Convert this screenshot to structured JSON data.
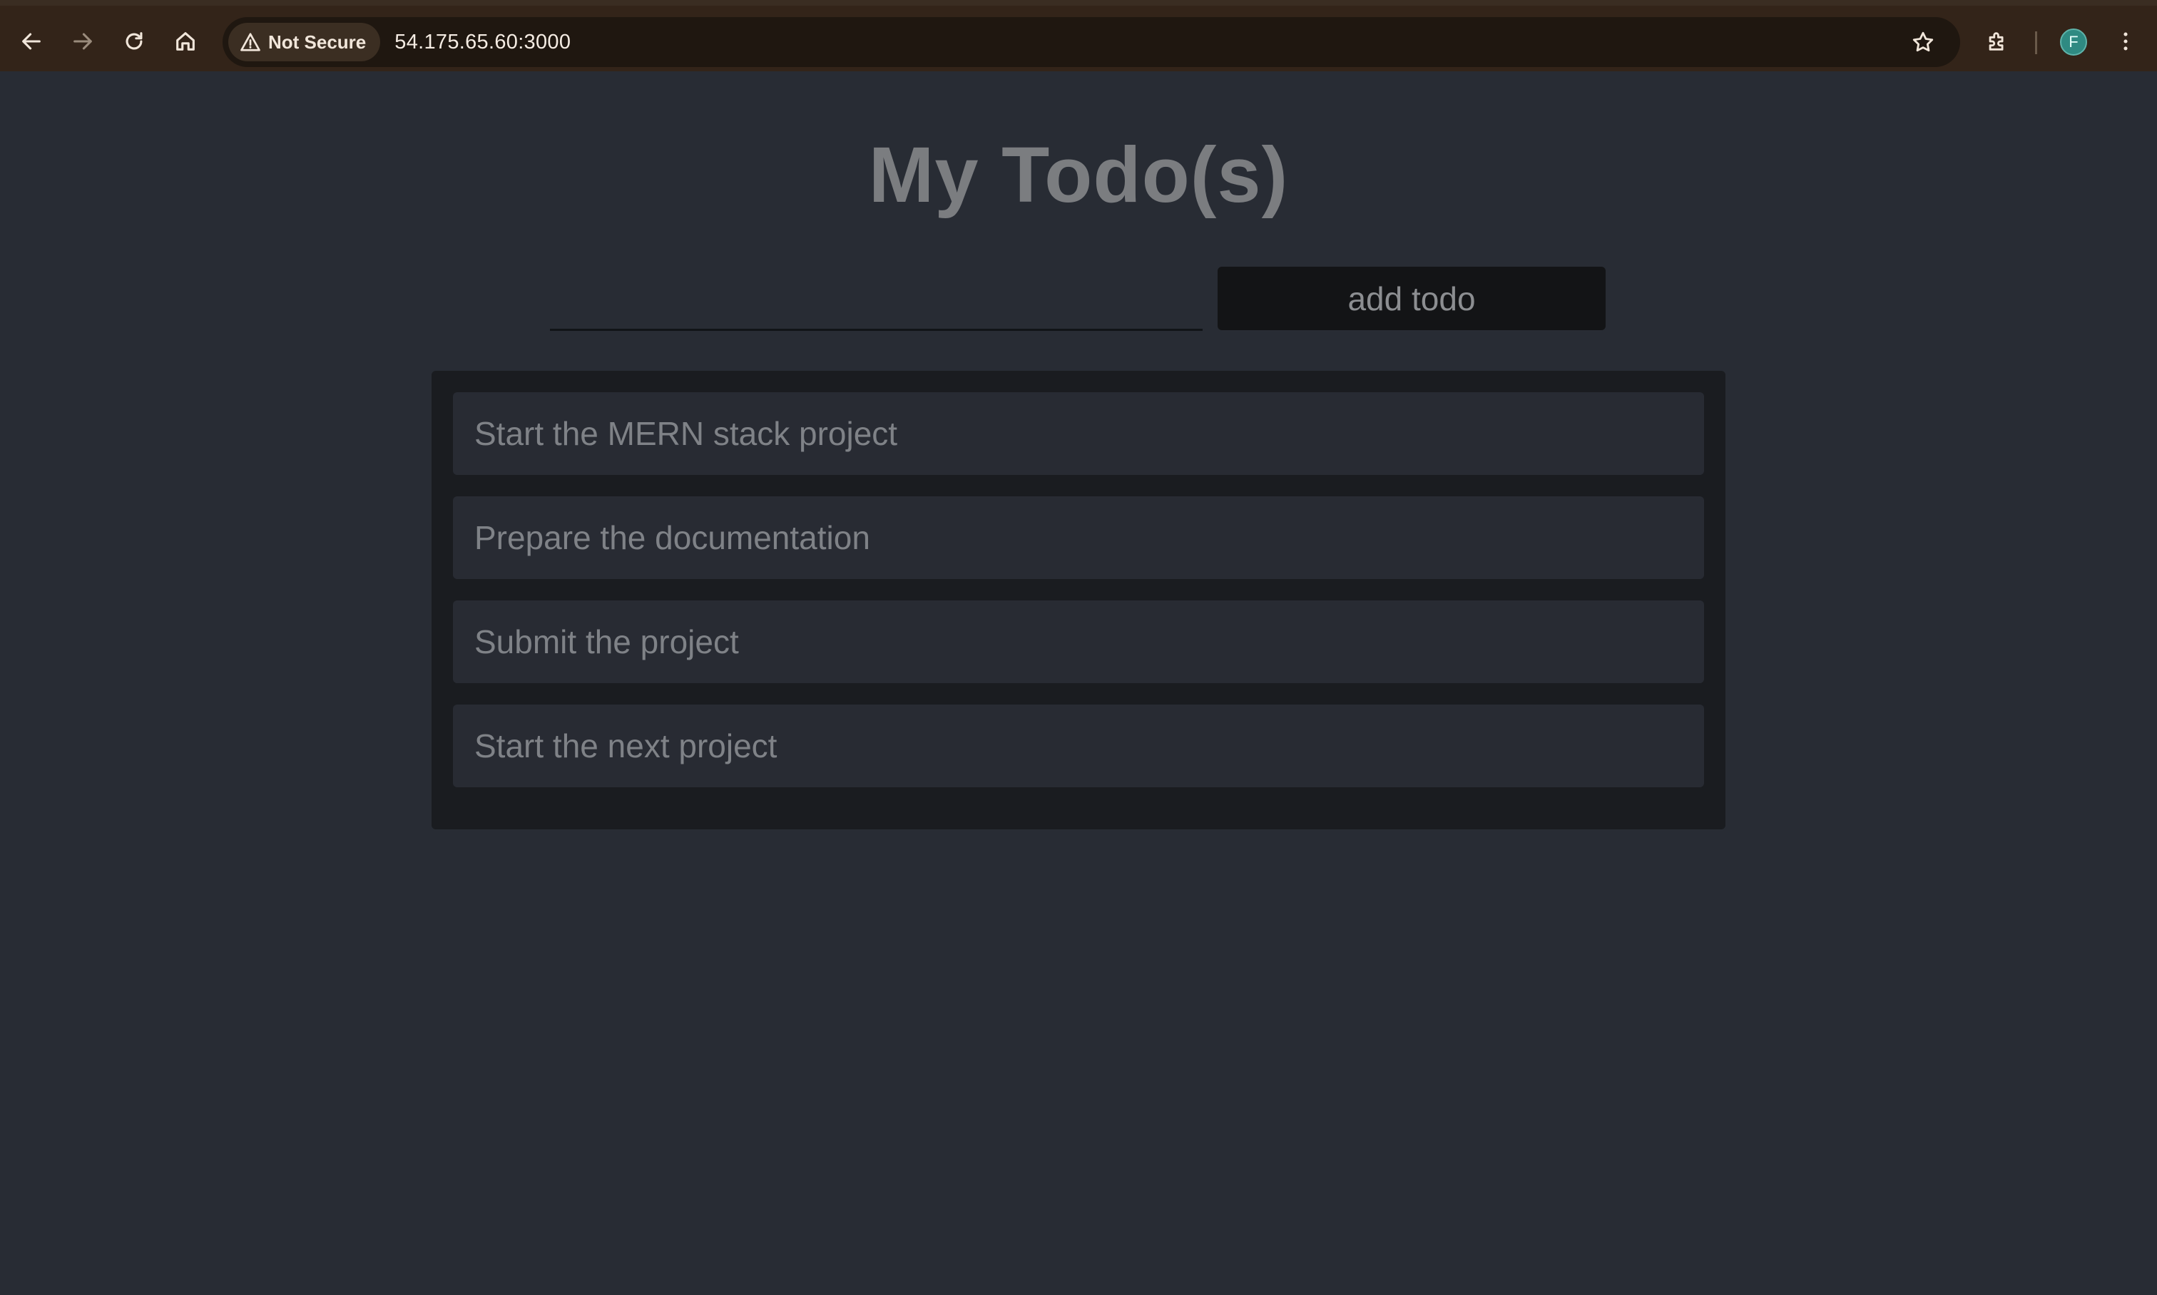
{
  "browser": {
    "security_label": "Not Secure",
    "url": "54.175.65.60:3000",
    "profile_initial": "F",
    "icons": [
      "back-arrow-icon",
      "forward-arrow-icon",
      "reload-icon",
      "home-icon",
      "warning-icon",
      "star-icon",
      "extensions-icon",
      "more-menu-icon"
    ]
  },
  "app": {
    "title": "My Todo(s)",
    "input": {
      "value": "",
      "placeholder": ""
    },
    "add_button_label": "add todo",
    "todos": [
      {
        "text": "Start the MERN stack project"
      },
      {
        "text": "Prepare the documentation"
      },
      {
        "text": "Submit the project"
      },
      {
        "text": "Start the next project"
      }
    ]
  },
  "colors": {
    "page_background": "#282c34",
    "panel_background": "#1a1c20",
    "item_background": "#282b33",
    "text_muted": "#7f8287",
    "browser_frame": "#332419"
  }
}
